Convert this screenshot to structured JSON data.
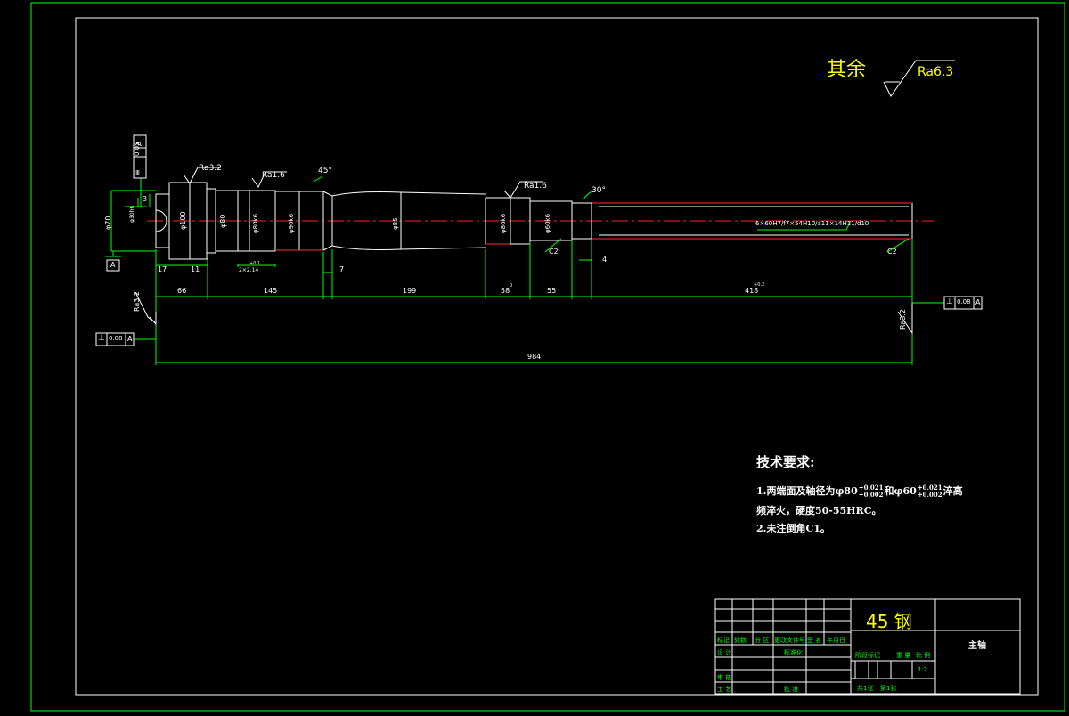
{
  "surface_note": {
    "label": "其余",
    "roughness": "Ra6.3"
  },
  "roughness_marks": [
    "Ra3.2",
    "Ra1.6",
    "Ra1.6",
    "Ra3.2",
    "Ra3.2"
  ],
  "angles": [
    "45°",
    "30°"
  ],
  "diameters": {
    "d70": "φ70",
    "d100": "φ100",
    "d80": "φ80",
    "d_small": "φ30h6",
    "d_mid": "φ80k6",
    "d_big": "φ90k6",
    "d_shaft": "φ85",
    "d_right1": "φ80k6",
    "d_right2": "φ60k6"
  },
  "tolerance_frames": [
    {
      "symbol": "≡",
      "value": "0.05",
      "datum": "A"
    },
    {
      "symbol": "⊥",
      "value": "0.08",
      "datum": "A"
    },
    {
      "symbol": "⊥",
      "value": "0.08",
      "datum": "A"
    }
  ],
  "datum_label": "A",
  "spline_label": "6×60H7/f7×54H10/a11×14H11/d10",
  "chamfers": [
    "C2",
    "C2"
  ],
  "dimensions": {
    "d3": "3",
    "d17": "17",
    "d11": "11",
    "d66": "66",
    "d145": "145",
    "d7": "7",
    "d199": "199",
    "d58": "58",
    "d55": "55",
    "d4": "4",
    "d418": "418",
    "d984": "984",
    "keyway": "2×2.14",
    "keyway_tol": "+0.1",
    "d58_tol": "0",
    "d418_tol": "+0.2"
  },
  "tech_requirements": {
    "title": "技术要求:",
    "line1_a": "1.两端面及轴径为φ80",
    "line1_tol1_top": "+0.021",
    "line1_tol1_bot": "+0.002",
    "line1_b": "和φ60",
    "line1_tol2_top": "+0.021",
    "line1_tol2_bot": "+0.002",
    "line1_c": "淬高",
    "line2": "频淬火，硬度50-55HRC。",
    "line3": "2.未注倒角C1。"
  },
  "title_block": {
    "material": "45 钢",
    "part_name": "主轴",
    "headers": [
      "标记",
      "处数",
      "分 区",
      "更改文件号",
      "签 名",
      "年月日"
    ],
    "row_design": "设 计",
    "row_standard": "标准化",
    "row_review": "审 核",
    "row_process": "工 艺",
    "row_approve": "批 准",
    "stage_label": "阶段标记",
    "weight_label": "重 量",
    "scale_label": "比 例",
    "scale_value": "1:2",
    "sheet_total": "共1张",
    "sheet_no": "第1张"
  }
}
